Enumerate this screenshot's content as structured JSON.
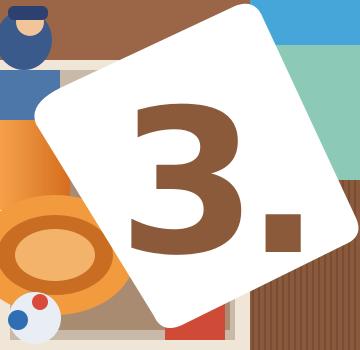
{
  "badge": {
    "label": "3."
  },
  "palette": {
    "wall_blue": "#4aa7d8",
    "wall_teal": "#8cc9b8",
    "wood": "#8a5a3c",
    "toy_orange": "#f08a2c",
    "badge_white": "#ffffff"
  }
}
